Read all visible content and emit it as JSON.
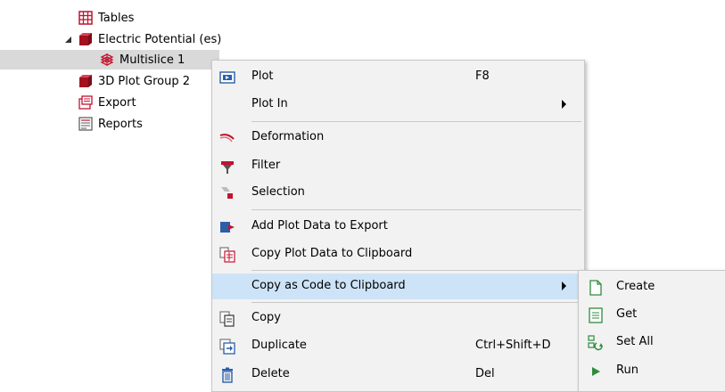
{
  "tree": {
    "items": [
      {
        "label": "Tables",
        "icon": "table-icon"
      },
      {
        "label": "Electric Potential (es)",
        "icon": "plot-group-icon"
      },
      {
        "label": "Multislice 1",
        "icon": "multislice-icon"
      },
      {
        "label": "3D Plot Group 2",
        "icon": "plot-group-icon"
      },
      {
        "label": "Export",
        "icon": "export-icon"
      },
      {
        "label": "Reports",
        "icon": "reports-icon"
      }
    ]
  },
  "context_menu": {
    "items": [
      {
        "label": "Plot",
        "shortcut": "F8",
        "icon": "plot-icon"
      },
      {
        "label": "Plot In",
        "icon": ""
      },
      {
        "label": "Deformation",
        "icon": "deformation-icon"
      },
      {
        "label": "Filter",
        "icon": "filter-icon"
      },
      {
        "label": "Selection",
        "icon": "selection-icon"
      },
      {
        "label": "Add Plot Data to Export",
        "icon": "add-export-icon"
      },
      {
        "label": "Copy Plot Data to Clipboard",
        "icon": "clipboard-icon"
      },
      {
        "label": "Copy as Code to Clipboard",
        "icon": ""
      },
      {
        "label": "Copy",
        "icon": "copy-icon"
      },
      {
        "label": "Duplicate",
        "shortcut": "Ctrl+Shift+D",
        "icon": "duplicate-icon"
      },
      {
        "label": "Delete",
        "shortcut": "Del",
        "icon": "trash-icon"
      }
    ]
  },
  "submenu": {
    "items": [
      {
        "label": "Create",
        "icon": "new-document-icon"
      },
      {
        "label": "Get",
        "icon": "list-document-icon"
      },
      {
        "label": "Set All",
        "icon": "set-all-icon"
      },
      {
        "label": "Run",
        "icon": "play-icon"
      }
    ]
  },
  "colors": {
    "menu_bg": "#f2f2f2",
    "hover_bg": "#cde3f7",
    "selected_tree_bg": "#d9d9d9",
    "brand_red": "#c4122f"
  }
}
